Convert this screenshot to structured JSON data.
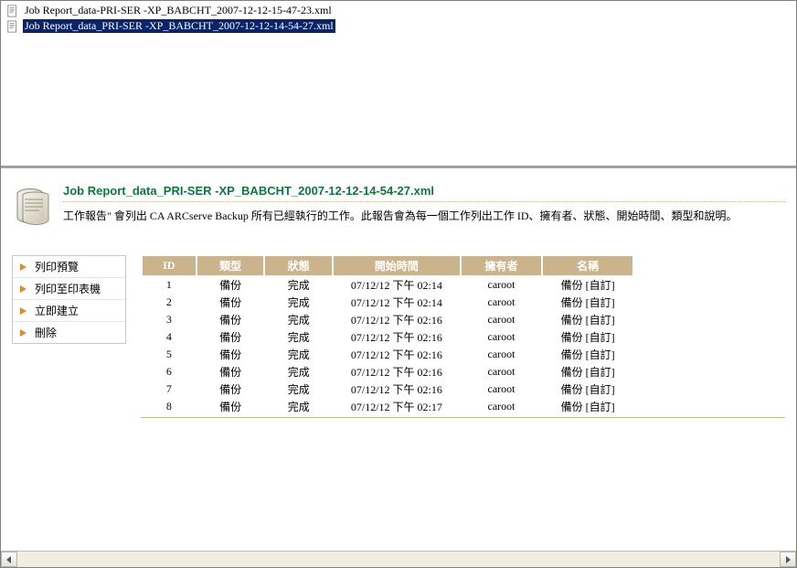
{
  "files": [
    {
      "name": "Job Report_data-PRI-SER -XP_BABCHT_2007-12-12-15-47-23.xml",
      "selected": false
    },
    {
      "name": "Job Report_data_PRI-SER -XP_BABCHT_2007-12-12-14-54-27.xml",
      "selected": true
    }
  ],
  "report": {
    "title": "Job Report_data_PRI-SER -XP_BABCHT_2007-12-12-14-54-27.xml",
    "description": "工作報告\" 會列出 CA ARCserve Backup 所有已經執行的工作。此報告會為每一個工作列出工作 ID、擁有者、狀態、開始時間、類型和說明。"
  },
  "sidebar": {
    "items": [
      {
        "label": "列印預覽"
      },
      {
        "label": "列印至印表機"
      },
      {
        "label": "立即建立"
      },
      {
        "label": "刪除"
      }
    ]
  },
  "table": {
    "headers": {
      "id": "ID",
      "type": "類型",
      "status": "狀態",
      "start": "開始時間",
      "owner": "擁有者",
      "name": "名稱"
    },
    "rows": [
      {
        "id": "1",
        "type": "備份",
        "status": "完成",
        "start": "07/12/12 下午 02:14",
        "owner": "caroot",
        "name": "備份 [自訂]"
      },
      {
        "id": "2",
        "type": "備份",
        "status": "完成",
        "start": "07/12/12 下午 02:14",
        "owner": "caroot",
        "name": "備份 [自訂]"
      },
      {
        "id": "3",
        "type": "備份",
        "status": "完成",
        "start": "07/12/12 下午 02:16",
        "owner": "caroot",
        "name": "備份 [自訂]"
      },
      {
        "id": "4",
        "type": "備份",
        "status": "完成",
        "start": "07/12/12 下午 02:16",
        "owner": "caroot",
        "name": "備份 [自訂]"
      },
      {
        "id": "5",
        "type": "備份",
        "status": "完成",
        "start": "07/12/12 下午 02:16",
        "owner": "caroot",
        "name": "備份 [自訂]"
      },
      {
        "id": "6",
        "type": "備份",
        "status": "完成",
        "start": "07/12/12 下午 02:16",
        "owner": "caroot",
        "name": "備份 [自訂]"
      },
      {
        "id": "7",
        "type": "備份",
        "status": "完成",
        "start": "07/12/12 下午 02:16",
        "owner": "caroot",
        "name": "備份 [自訂]"
      },
      {
        "id": "8",
        "type": "備份",
        "status": "完成",
        "start": "07/12/12 下午 02:17",
        "owner": "caroot",
        "name": "備份 [自訂]"
      }
    ]
  }
}
